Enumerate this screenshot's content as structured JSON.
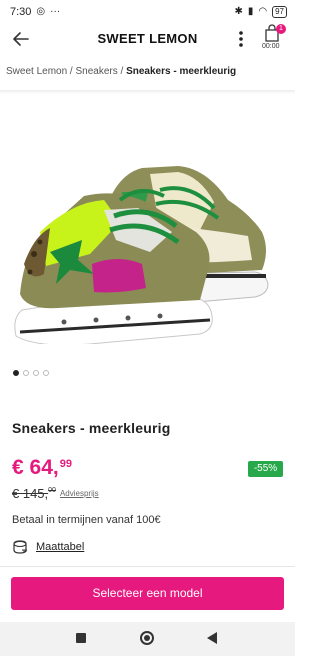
{
  "status_bar": {
    "time": "7:30",
    "battery": "97"
  },
  "header": {
    "brand": "SWEET LEMON",
    "cart_count": "1",
    "cart_time": "00:00"
  },
  "breadcrumb": {
    "items": [
      "Sweet Lemon",
      "Sneakers"
    ],
    "separator": " / ",
    "current": "Sneakers - meerkleurig"
  },
  "product": {
    "title": "Sneakers - meerkleurig",
    "price_main": "€ 64,",
    "price_cents": "99",
    "discount": "-55%",
    "old_price_main": "€ 145,",
    "old_price_cents": "00",
    "advies_label": "Adviesprijs",
    "installments": "Betaal in termijnen vanaf 100€",
    "size_chart_label": "Maattabel",
    "image_count": 4,
    "active_image_index": 0
  },
  "actions": {
    "select_label": "Selecteer een model"
  },
  "colors": {
    "accent": "#e6197e",
    "discount": "#27a84a"
  },
  "icons": {
    "back": "arrow-left-icon",
    "more": "more-vertical-icon",
    "cart": "shopping-bag-icon",
    "size": "tape-measure-icon"
  }
}
